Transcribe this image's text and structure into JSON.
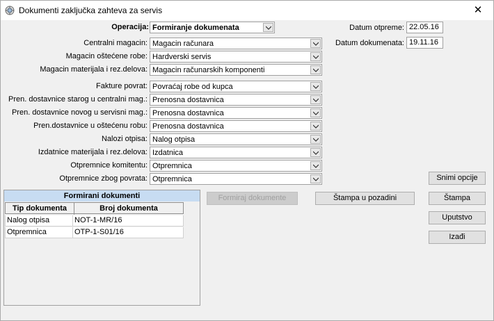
{
  "window": {
    "title": "Dokumenti zaključka zahteva za servis",
    "close_glyph": "✕"
  },
  "form": {
    "operacija": {
      "label": "Operacija:",
      "value": "Formiranje dokumenata"
    },
    "fields": [
      {
        "label": "Centralni magacin:",
        "value": "Magacin računara"
      },
      {
        "label": "Magacin oštećene robe:",
        "value": "Hardverski servis"
      },
      {
        "label": "Magacin materijala i rez.delova:",
        "value": "Magacin računarskih komponenti"
      },
      {
        "label": "Fakture povrat:",
        "value": "Povraćaj robe od kupca"
      },
      {
        "label": "Pren. dostavnice starog u centralni mag.:",
        "value": "Prenosna dostavnica"
      },
      {
        "label": "Pren. dostavnice novog u servisni mag.:",
        "value": "Prenosna dostavnica"
      },
      {
        "label": "Pren.dostavnice u oštećenu robu:",
        "value": "Prenosna dostavnica"
      },
      {
        "label": "Nalozi otpisa:",
        "value": "Nalog otpisa"
      },
      {
        "label": "Izdatnice materijala i rez.delova:",
        "value": "Izdatnica"
      },
      {
        "label": "Otpremnice komitentu:",
        "value": "Otpremnica"
      },
      {
        "label": "Otpremnice zbog povrata:",
        "value": "Otpremnica"
      }
    ],
    "datum_otpreme": {
      "label": "Datum otpreme:",
      "value": "22.05.16"
    },
    "datum_dokumenata": {
      "label": "Datum dokumenata:",
      "value": "19.11.16"
    }
  },
  "documents_panel": {
    "title": "Formirani dokumenti",
    "columns": [
      "Tip dokumenta",
      "Broj dokumenta"
    ],
    "rows": [
      [
        "Nalog otpisa",
        "NOT-1-MR/16"
      ],
      [
        "Otpremnica",
        "OTP-1-S01/16"
      ]
    ]
  },
  "buttons": {
    "formiraj": "Formiraj dokumente",
    "stampa_pozadina": "Štampa u pozadini",
    "snimi_opcije": "Snimi opcije",
    "stampa": "Štampa",
    "uputstvo": "Uputstvo",
    "izadji": "Izađi"
  }
}
